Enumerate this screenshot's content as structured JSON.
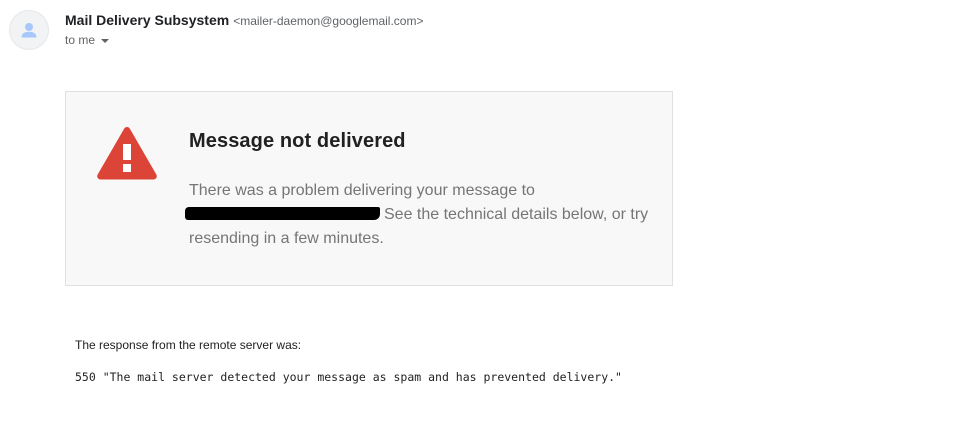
{
  "sender": {
    "name": "Mail Delivery Subsystem",
    "email": "<mailer-daemon@googlemail.com>",
    "avatar_icon": "person-icon"
  },
  "recipient": {
    "label": "to me",
    "dropdown_icon": "caret-down-icon"
  },
  "notice": {
    "icon": "warning-icon",
    "icon_color": "#db4437",
    "title": "Message not delivered",
    "body_before_redaction": "There was a problem delivering your message to",
    "body_after_redaction": "See the technical details below, or try resending in a few minutes."
  },
  "response": {
    "label": "The response from the remote server was:",
    "message": "550 \"The mail server detected your message as spam and has prevented delivery.\""
  }
}
